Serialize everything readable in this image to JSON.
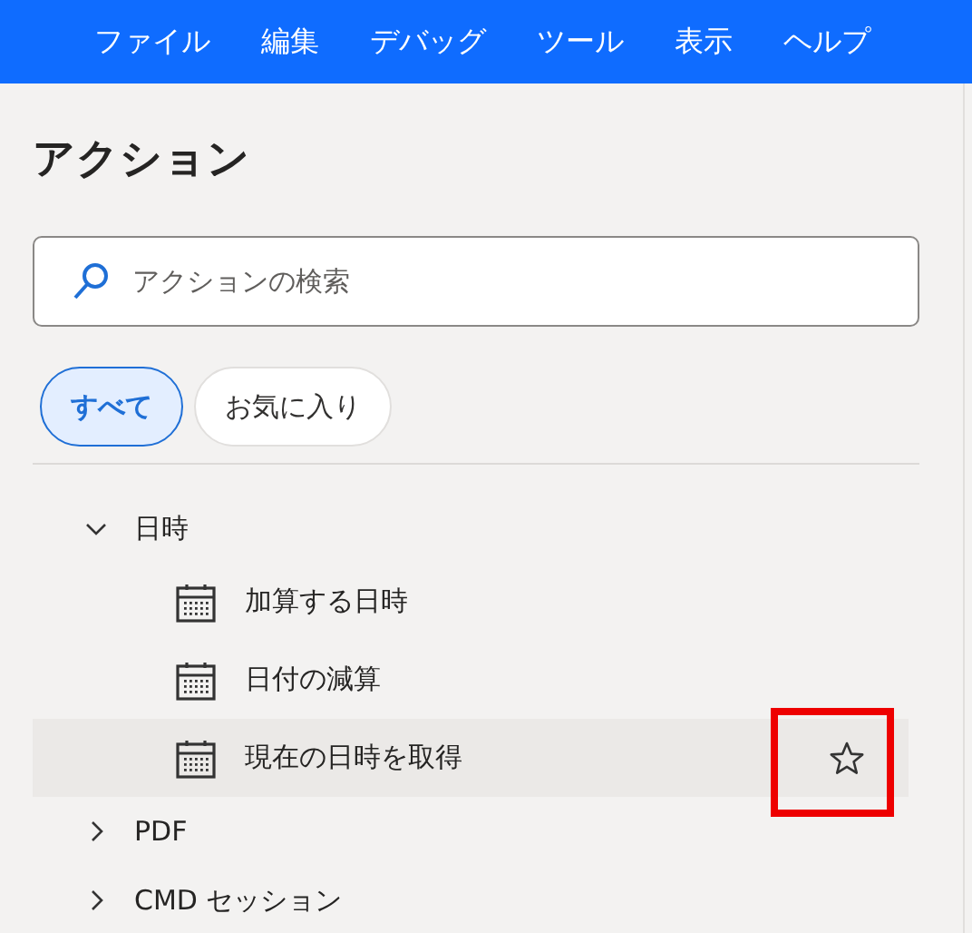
{
  "menu_bar": {
    "items": [
      "ファイル",
      "編集",
      "デバッグ",
      "ツール",
      "表示",
      "ヘルプ"
    ]
  },
  "panel": {
    "title": "アクション",
    "search": {
      "placeholder": "アクションの検索"
    },
    "filters": [
      {
        "label": "すべて",
        "selected": true
      },
      {
        "label": "お気に入り",
        "selected": false
      }
    ],
    "tree": [
      {
        "label": "日時",
        "expanded": true,
        "children": [
          {
            "label": "加算する日時",
            "hovered": false,
            "marked": false
          },
          {
            "label": "日付の減算",
            "hovered": false,
            "marked": false
          },
          {
            "label": "現在の日時を取得",
            "hovered": true,
            "marked": true
          }
        ]
      },
      {
        "label": "PDF",
        "expanded": false
      },
      {
        "label": "CMD セッション",
        "expanded": false
      }
    ]
  }
}
